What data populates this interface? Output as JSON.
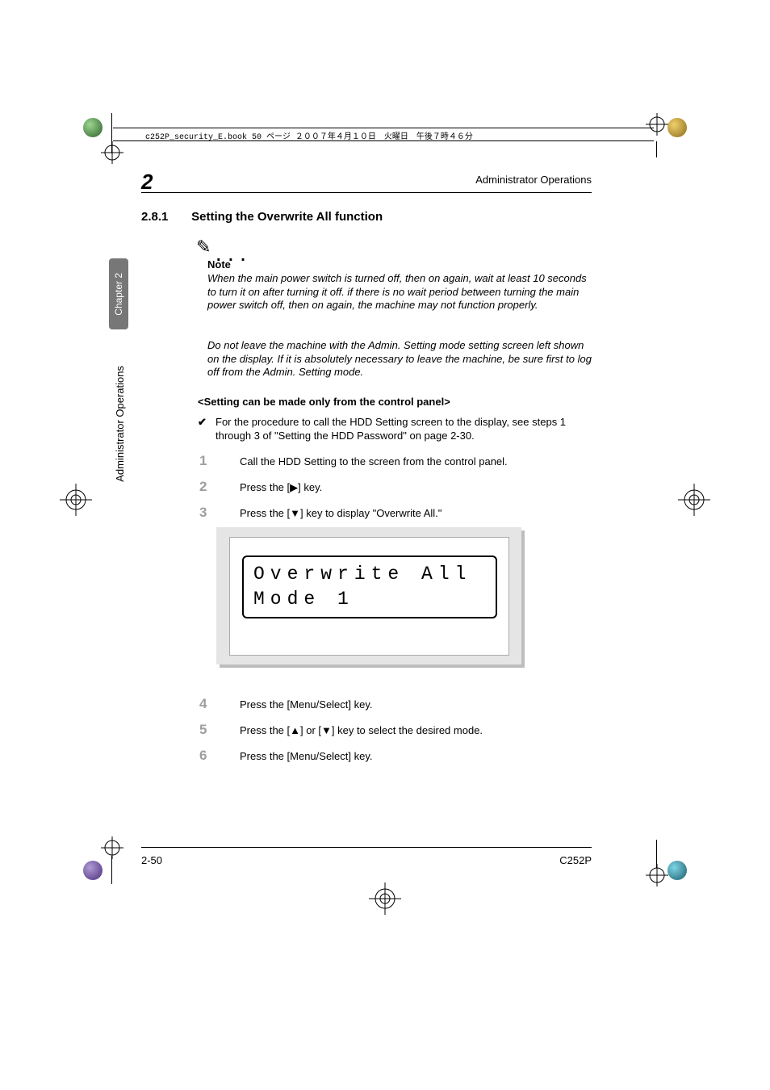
{
  "book_header": "c252P_security_E.book  50 ページ  ２００７年４月１０日　火曜日　午後７時４６分",
  "running_head": "Administrator Operations",
  "chapter_number": "2",
  "side_tab": "Chapter 2",
  "side_label": "Administrator Operations",
  "section": {
    "number": "2.8.1",
    "title": "Setting the Overwrite All function"
  },
  "note": {
    "label": "Note",
    "para1": "When the main power switch is turned off, then on again, wait at least 10 seconds to turn it on after turning it off. if there is no wait period between turning the main power switch off, then on again, the machine may not function properly.",
    "para2": "Do not leave the machine with the Admin. Setting mode setting screen left shown on the display. If it is absolutely necessary to leave the machine, be sure first to log off from the Admin. Setting mode."
  },
  "subhead": "<Setting can be made only from the control panel>",
  "check_bullet": "For the procedure to call the HDD Setting screen to the display, see steps 1 through 3 of \"Setting the HDD Password\" on page 2-30.",
  "steps": {
    "s1": "Call the HDD Setting to the screen from the control panel.",
    "s2": "Press the [▶] key.",
    "s3": "Press the [▼] key to display \"Overwrite All.\"",
    "s4": "Press the [Menu/Select] key.",
    "s5": "Press the [▲] or [▼] key to select the desired mode.",
    "s6": "Press the [Menu/Select] key."
  },
  "lcd": {
    "line1": "Overwrite All",
    "line2": "Mode 1"
  },
  "footer": {
    "left": "2-50",
    "right": "C252P"
  }
}
